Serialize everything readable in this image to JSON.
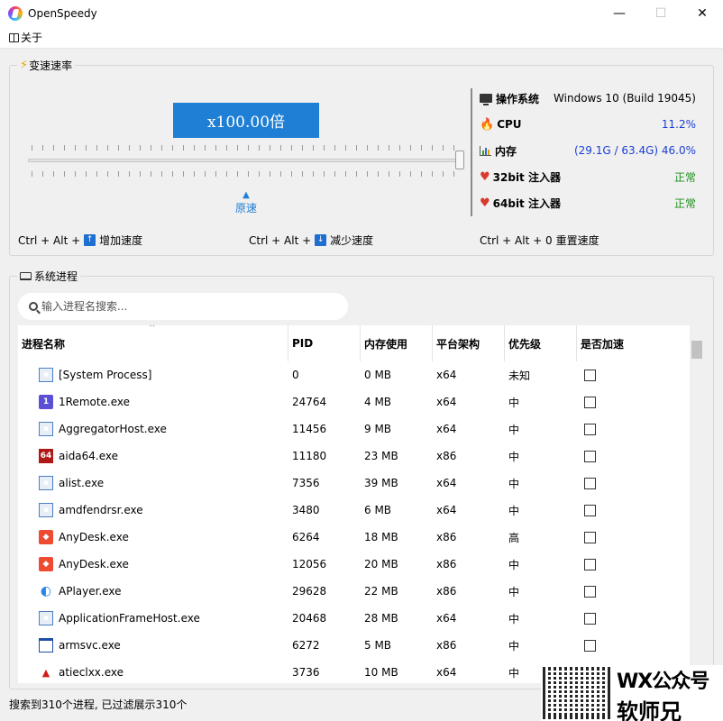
{
  "window": {
    "title": "OpenSpeedy",
    "minimize": "—",
    "maximize": "☐",
    "close": "✕"
  },
  "menu": {
    "about": "关于"
  },
  "speed_group": {
    "legend": "变速速率",
    "display": "x100.00倍",
    "reset_label": "原速",
    "reset_arrow": "▲",
    "hotkeys": [
      {
        "prefix": "Ctrl + Alt +",
        "key": "↑",
        "label": "增加速度"
      },
      {
        "prefix": "Ctrl + Alt +",
        "key": "↓",
        "label": "减少速度"
      },
      {
        "prefix": "Ctrl + Alt + 0",
        "key": "",
        "label": "重置速度"
      }
    ]
  },
  "system_info": {
    "os_label": "操作系统",
    "os_value": "Windows 10 (Build 19045)",
    "cpu_label": "CPU",
    "cpu_value": "11.2%",
    "mem_label": "内存",
    "mem_value": "(29.1G / 63.4G) 46.0%",
    "inj32_label": "32bit 注入器",
    "inj32_value": "正常",
    "inj64_label": "64bit 注入器",
    "inj64_value": "正常"
  },
  "process_group": {
    "legend": "系统进程",
    "search_placeholder": "输入进程名搜索...",
    "columns": [
      "进程名称",
      "PID",
      "内存使用",
      "平台架构",
      "优先级",
      "是否加速"
    ],
    "sort_caret": "^",
    "rows": [
      {
        "name": "[System Process]",
        "pid": "0",
        "mem": "0 MB",
        "arch": "x64",
        "priority": "未知",
        "icon": "window-icon"
      },
      {
        "name": "1Remote.exe",
        "pid": "24764",
        "mem": "4 MB",
        "arch": "x64",
        "priority": "中",
        "icon": "remote-icon"
      },
      {
        "name": "AggregatorHost.exe",
        "pid": "11456",
        "mem": "9 MB",
        "arch": "x64",
        "priority": "中",
        "icon": "window-icon"
      },
      {
        "name": "aida64.exe",
        "pid": "11180",
        "mem": "23 MB",
        "arch": "x86",
        "priority": "中",
        "icon": "aida64-icon"
      },
      {
        "name": "alist.exe",
        "pid": "7356",
        "mem": "39 MB",
        "arch": "x64",
        "priority": "中",
        "icon": "window-icon"
      },
      {
        "name": "amdfendrsr.exe",
        "pid": "3480",
        "mem": "6 MB",
        "arch": "x64",
        "priority": "中",
        "icon": "window-icon"
      },
      {
        "name": "AnyDesk.exe",
        "pid": "6264",
        "mem": "18 MB",
        "arch": "x86",
        "priority": "高",
        "icon": "anydesk-icon"
      },
      {
        "name": "AnyDesk.exe",
        "pid": "12056",
        "mem": "20 MB",
        "arch": "x86",
        "priority": "中",
        "icon": "anydesk-icon"
      },
      {
        "name": "APlayer.exe",
        "pid": "29628",
        "mem": "22 MB",
        "arch": "x86",
        "priority": "中",
        "icon": "aplayer-icon"
      },
      {
        "name": "ApplicationFrameHost.exe",
        "pid": "20468",
        "mem": "28 MB",
        "arch": "x64",
        "priority": "中",
        "icon": "window-icon"
      },
      {
        "name": "armsvc.exe",
        "pid": "6272",
        "mem": "5 MB",
        "arch": "x86",
        "priority": "中",
        "icon": "frame-icon"
      },
      {
        "name": "atieclxx.exe",
        "pid": "3736",
        "mem": "10 MB",
        "arch": "x64",
        "priority": "中",
        "icon": "amd-icon"
      }
    ]
  },
  "status": "搜索到310个进程, 已过滤展示310个",
  "watermark": {
    "line1": "WX公众号",
    "line2": "软师兄"
  },
  "colors": {
    "accent": "#1e7fd4",
    "ok": "#1b8f1b",
    "value_blue": "#1a3fd6"
  }
}
